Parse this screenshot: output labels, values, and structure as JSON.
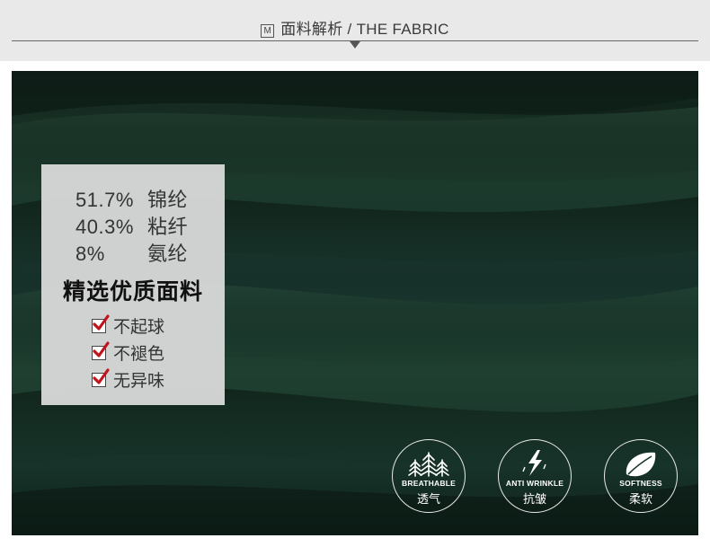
{
  "header": {
    "icon": "M",
    "title": "面料解析 / THE FABRIC"
  },
  "composition": [
    {
      "percent": "51.7%",
      "material": "锦纶"
    },
    {
      "percent": "40.3%",
      "material": "粘纤"
    },
    {
      "percent": "8%",
      "material": "氨纶"
    }
  ],
  "panel": {
    "heading": "精选优质面料",
    "features": [
      "不起球",
      "不褪色",
      "无异味"
    ]
  },
  "badges": [
    {
      "icon": "trees-icon",
      "en": "BREATHABLE",
      "zh": "透气"
    },
    {
      "icon": "lightning-icon",
      "en": "ANTI WRINKLE",
      "zh": "抗皱"
    },
    {
      "icon": "leaf-icon",
      "en": "SOFTNESS",
      "zh": "柔软"
    }
  ],
  "colors": {
    "fabric": "#1c3a2c",
    "check": "#c0141c",
    "header_bg": "#e9e9e9"
  }
}
